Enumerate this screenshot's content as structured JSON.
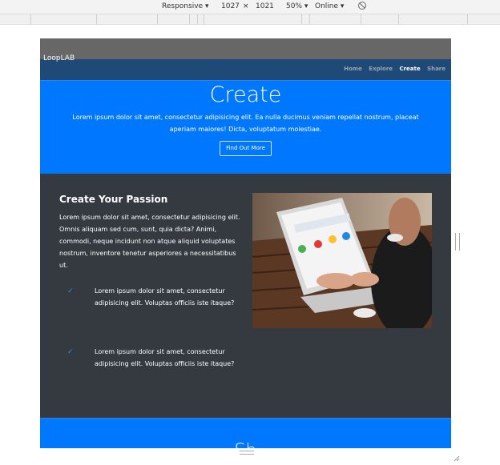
{
  "devtools": {
    "device": "Responsive",
    "width": "1027",
    "times": "×",
    "height": "1021",
    "zoom": "50%",
    "throttle": "Online",
    "rotate_icon": "rotate-icon",
    "caret": "▾"
  },
  "site": {
    "brand": "LoopLAB",
    "nav": [
      "Home",
      "Explore",
      "Create",
      "Share"
    ],
    "active_nav": "Create",
    "hero": {
      "title": "Create",
      "text": "Lorem ipsum dolor sit amet, consectetur adipisicing elit. Ea nulla ducimus veniam repellat nostrum, placeat aperiam maiores! Dicta, voluptatum molestiae.",
      "button": "Find Out More"
    },
    "section": {
      "title": "Create Your Passion",
      "text": "Lorem ipsum dolor sit amet, consectetur adipisicing elit. Omnis aliquam sed cum, sunt, quia dicta? Animi, commodi, neque incidunt non atque aliquid voluptates nostrum, inventore tenetur asperiores a necessitatibus ut.",
      "features": [
        "Lorem ipsum dolor sit amet, consectetur adipisicing elit. Voluptas officiis iste itaque?",
        "Lorem ipsum dolor sit amet, consectetur adipisicing elit. Voluptas officiis iste itaque?"
      ],
      "check_glyph": "✓"
    },
    "next_title": "Sh"
  },
  "colors": {
    "hero": "#0077ff",
    "navbar": "#1f4a78",
    "section": "#343a40",
    "check": "#2f8cf0"
  }
}
